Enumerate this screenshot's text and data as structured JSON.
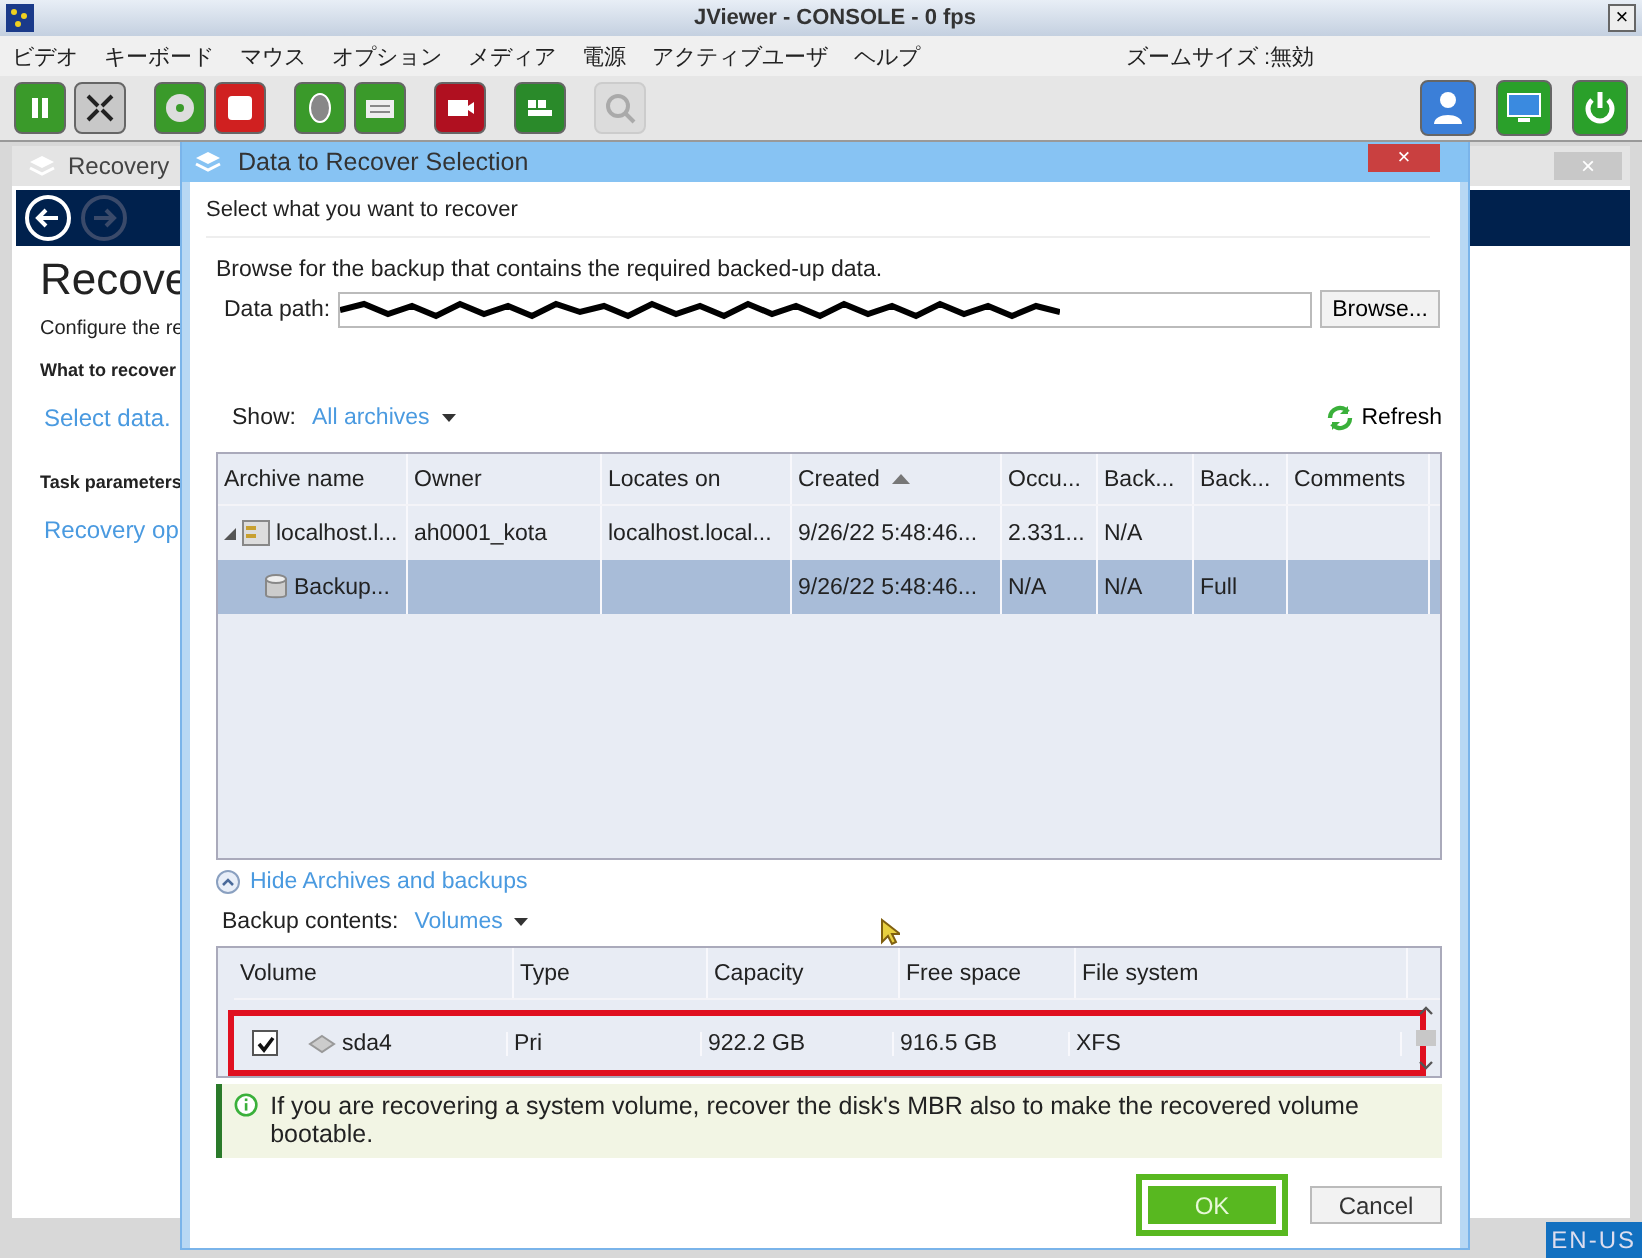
{
  "window": {
    "title": "JViewer - CONSOLE - 0 fps",
    "close": "×"
  },
  "menu": [
    {
      "label": "ビデオ"
    },
    {
      "label": "キーボード"
    },
    {
      "label": "マウス"
    },
    {
      "label": "オプション"
    },
    {
      "label": "メディア"
    },
    {
      "label": "電源"
    },
    {
      "label": "アクティブユーザ"
    },
    {
      "label": "ヘルプ"
    }
  ],
  "zoom_status": "ズームサイズ :無効",
  "toolbar_left": [
    {
      "kind": "pause",
      "disabled": false
    },
    {
      "kind": "fullscreen",
      "disabled": false
    },
    {
      "kind": "disc",
      "disabled": false
    },
    {
      "kind": "floppy",
      "disabled": false
    },
    {
      "kind": "mouse",
      "disabled": false
    },
    {
      "kind": "keyboard",
      "disabled": false
    },
    {
      "kind": "record",
      "disabled": false
    },
    {
      "kind": "keys",
      "disabled": false
    },
    {
      "kind": "zoom",
      "disabled": true
    }
  ],
  "toolbar_right": [
    {
      "kind": "user",
      "disabled": false
    },
    {
      "kind": "monitor",
      "disabled": false
    },
    {
      "kind": "power",
      "disabled": false
    }
  ],
  "background": {
    "tab": "Recovery",
    "close": "×",
    "heading": "Recove",
    "subtitle": "Configure the re",
    "section_1": "What to recover",
    "link_1": "Select data.",
    "section_2": "Task parameters",
    "link_2": "Recovery op"
  },
  "dialog": {
    "title": "Data to Recover Selection",
    "close": "×",
    "header": "Select what you want to recover",
    "intro": "Browse for the backup that contains the required backed-up data.",
    "path_label": "Data path:",
    "browse": "Browse...",
    "show_label": "Show:",
    "show_value": "All archives",
    "refresh": "Refresh",
    "archive_columns": [
      {
        "label": "Archive name",
        "sorted": false
      },
      {
        "label": "Owner",
        "sorted": false
      },
      {
        "label": "Locates on",
        "sorted": false
      },
      {
        "label": "Created",
        "sorted": true
      },
      {
        "label": "Occu...",
        "sorted": false
      },
      {
        "label": "Back...",
        "sorted": false
      },
      {
        "label": "Back...",
        "sorted": false
      },
      {
        "label": "Comments",
        "sorted": false
      }
    ],
    "archive_rows": [
      {
        "kind": "archive",
        "expanded": true,
        "selected": false,
        "cells": [
          "localhost.l...",
          "ah0001_kota",
          "localhost.local...",
          "9/26/22 5:48:46...",
          "2.331...",
          "N/A",
          "",
          ""
        ]
      },
      {
        "kind": "backup",
        "selected": true,
        "cells": [
          "Backup...",
          "",
          "",
          "9/26/22 5:48:46...",
          "N/A",
          "N/A",
          "Full",
          ""
        ]
      }
    ],
    "hide_link": "Hide Archives and backups",
    "contents_label": "Backup contents:",
    "contents_value": "Volumes",
    "volume_columns": [
      "Volume",
      "Type",
      "Capacity",
      "Free space",
      "File system"
    ],
    "volume_rows": [
      {
        "checked": true,
        "highlighted": true,
        "cells": [
          "sda4",
          "Pri",
          "922.2 GB",
          "916.5 GB",
          "XFS"
        ]
      }
    ],
    "info": "If you are recovering a system volume, recover the disk's MBR also to make the recovered volume bootable.",
    "buttons": [
      {
        "label": "OK",
        "kind": "primary",
        "highlighted": true
      },
      {
        "label": "Cancel",
        "kind": "secondary",
        "highlighted": false
      }
    ]
  },
  "language": "EN-US"
}
